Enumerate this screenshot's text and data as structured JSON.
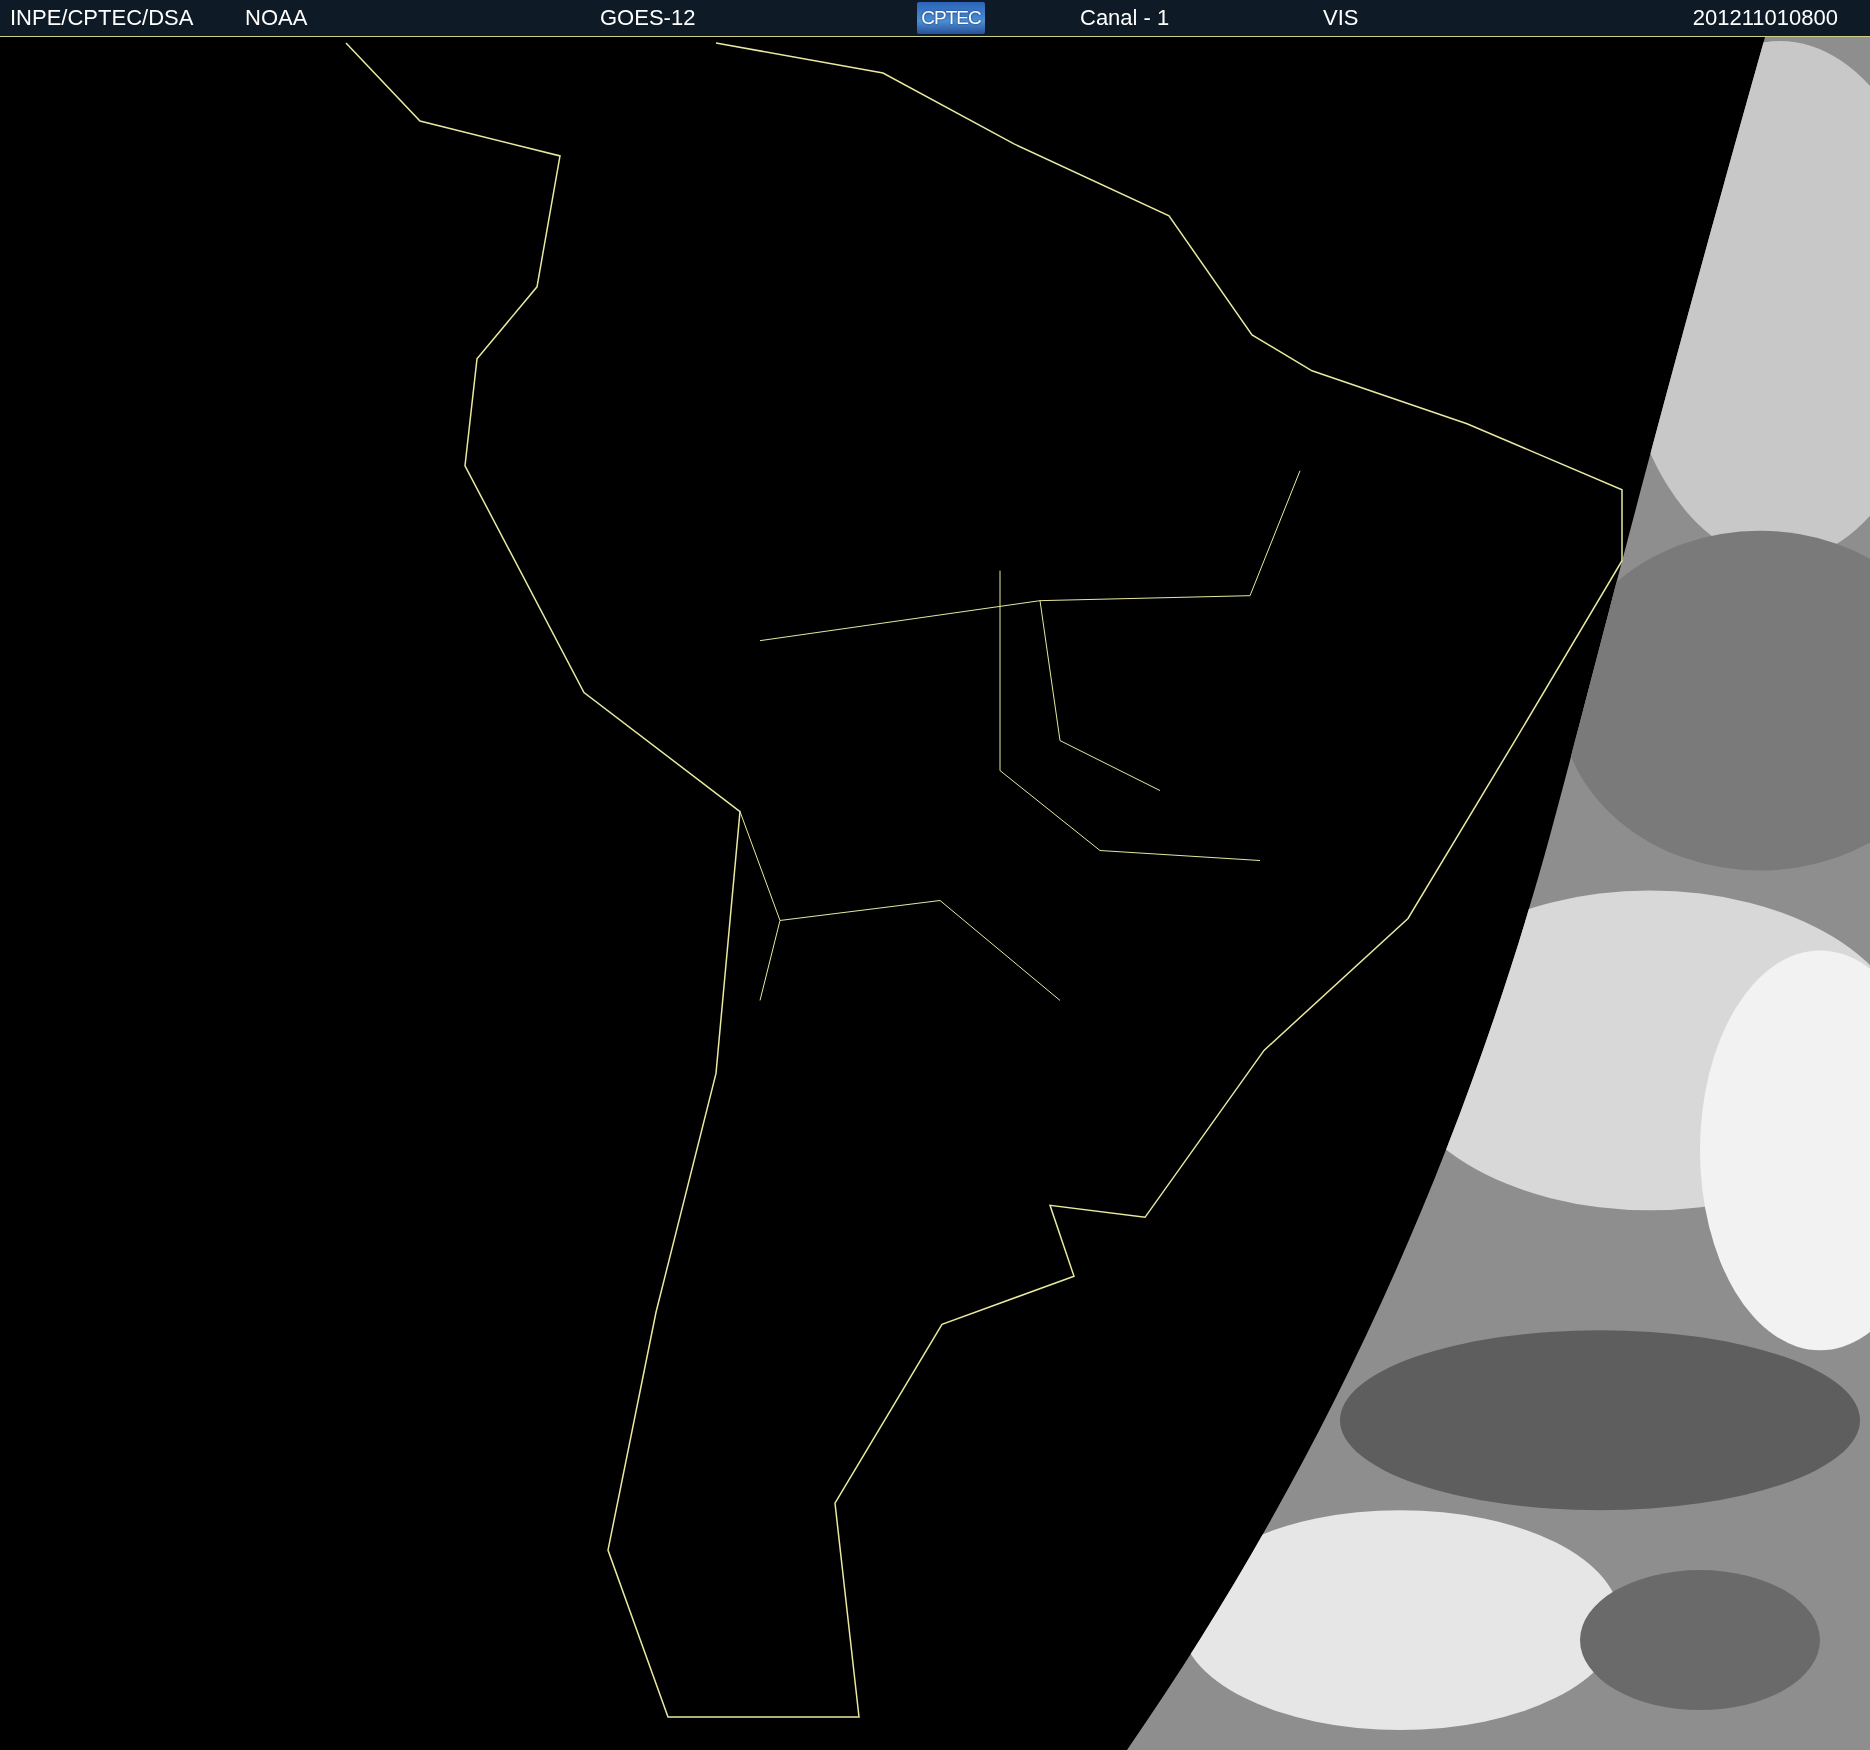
{
  "header": {
    "items": [
      {
        "kind": "label",
        "text": "INPE/CPTEC/DSA"
      },
      {
        "kind": "label",
        "text": "NOAA"
      },
      {
        "kind": "label",
        "text": "GOES-12"
      },
      {
        "kind": "logo",
        "text": "CPTEC"
      },
      {
        "kind": "label",
        "text": "Canal - 1"
      },
      {
        "kind": "label",
        "text": "VIS"
      },
      {
        "kind": "label",
        "text": "201211010800"
      }
    ]
  }
}
